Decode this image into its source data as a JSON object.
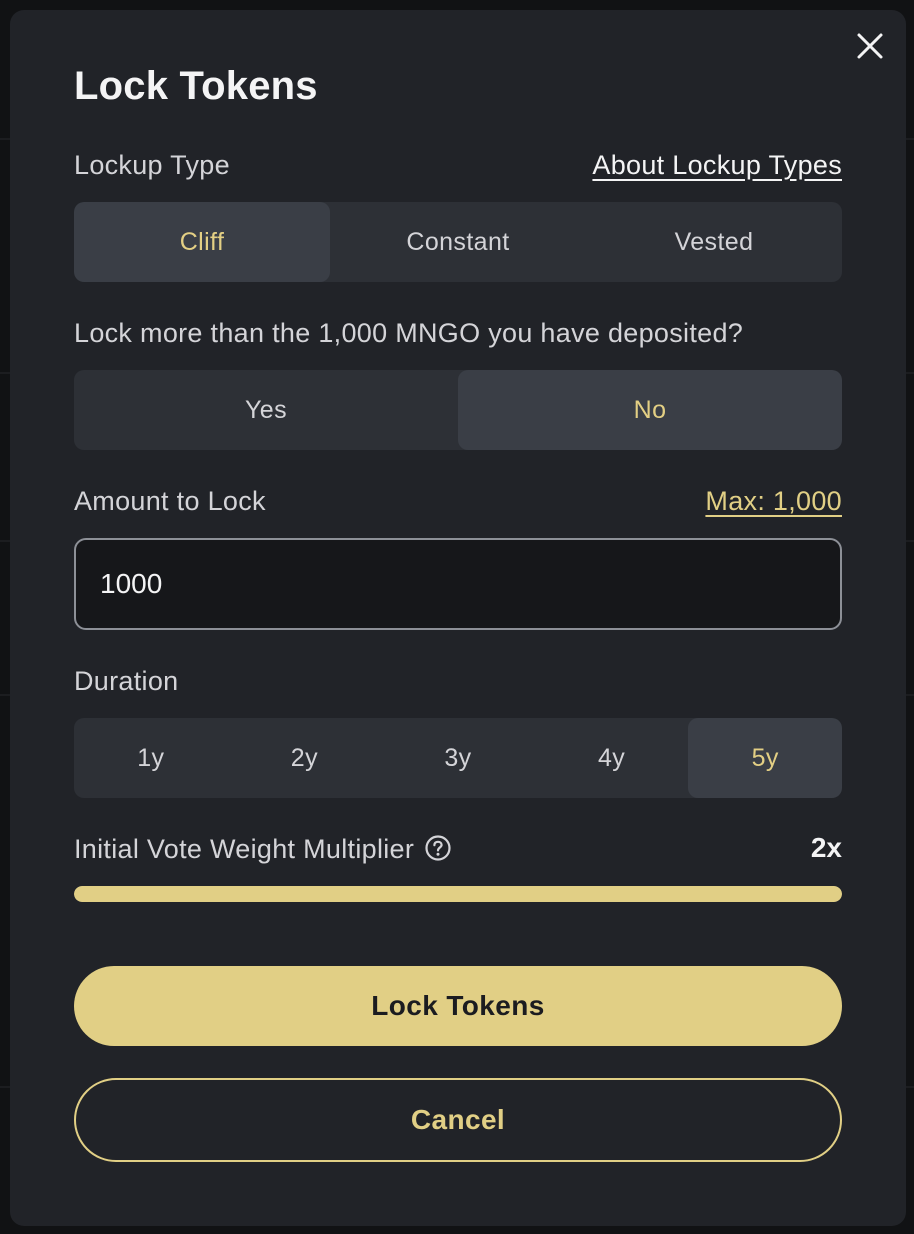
{
  "modal": {
    "title": "Lock Tokens",
    "close_icon": "close-icon"
  },
  "lockup": {
    "label": "Lockup Type",
    "about_link": "About Lockup Types",
    "options": [
      "Cliff",
      "Constant",
      "Vested"
    ],
    "selected": "Cliff"
  },
  "lock_more": {
    "question": "Lock more than the 1,000 MNGO you have deposited?",
    "options": [
      "Yes",
      "No"
    ],
    "selected": "No"
  },
  "amount": {
    "label": "Amount to Lock",
    "max_link": "Max: 1,000",
    "value": "1000"
  },
  "duration": {
    "label": "Duration",
    "options": [
      "1y",
      "2y",
      "3y",
      "4y",
      "5y"
    ],
    "selected": "5y"
  },
  "multiplier": {
    "label": "Initial Vote Weight Multiplier",
    "help_icon": "help-circle-icon",
    "value": "2x",
    "progress_fraction": 1.0
  },
  "actions": {
    "primary": "Lock Tokens",
    "secondary": "Cancel"
  },
  "colors": {
    "accent": "#e1cf85",
    "modal_bg": "#212328",
    "segment_bg": "#2d3036",
    "segment_active_bg": "#3a3e46"
  }
}
